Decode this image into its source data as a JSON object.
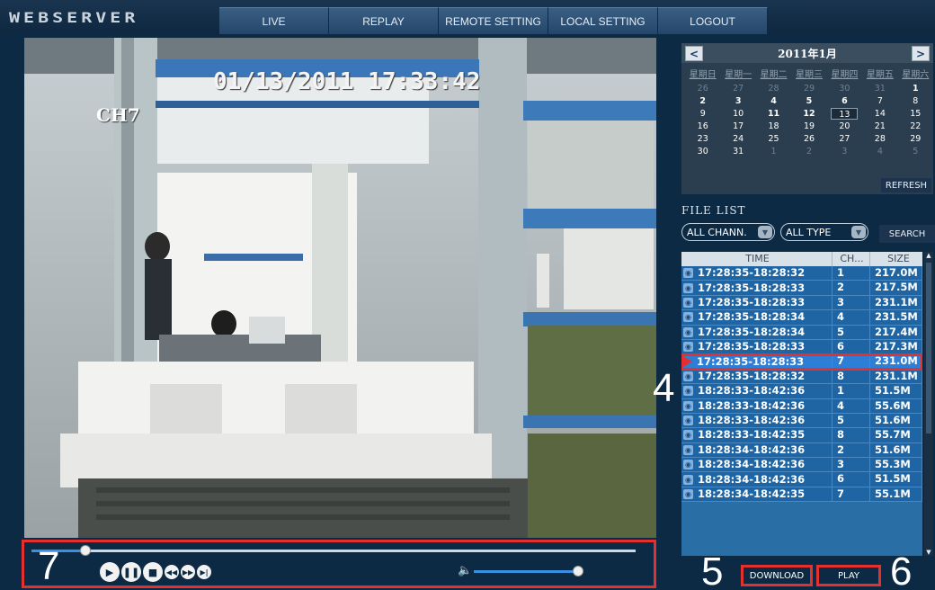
{
  "app": {
    "logo": "WEBSERVER"
  },
  "nav": {
    "tabs": [
      "LIVE",
      "REPLAY",
      "REMOTE SETTING",
      "LOCAL SETTING",
      "LOGOUT"
    ]
  },
  "video": {
    "timestamp": "01/13/2011 17:33:42",
    "channel": "CH7"
  },
  "player": {
    "progress": 0.09,
    "volume": 1.0,
    "buttons": [
      "play-icon",
      "pause-icon",
      "stop-icon",
      "rewind-icon",
      "fast-forward-icon",
      "step-icon"
    ],
    "volume_icon": "speaker-icon"
  },
  "callouts": {
    "four": "4",
    "five": "5",
    "six": "6",
    "seven": "7"
  },
  "calendar": {
    "prev": "<",
    "next": ">",
    "month": "2011年1月",
    "weekdays": [
      "星期日",
      "星期一",
      "星期二",
      "星期三",
      "星期四",
      "星期五",
      "星期六"
    ],
    "days": [
      [
        "26",
        "m"
      ],
      [
        "27",
        "m"
      ],
      [
        "28",
        "m"
      ],
      [
        "29",
        "m"
      ],
      [
        "30",
        "m"
      ],
      [
        "31",
        "m"
      ],
      [
        "1",
        "b"
      ],
      [
        "2",
        "b"
      ],
      [
        "3",
        "b"
      ],
      [
        "4",
        "b"
      ],
      [
        "5",
        "b"
      ],
      [
        "6",
        "b"
      ],
      [
        "7",
        ""
      ],
      [
        "8",
        ""
      ],
      [
        "9",
        ""
      ],
      [
        "10",
        ""
      ],
      [
        "11",
        "b"
      ],
      [
        "12",
        "b"
      ],
      [
        "13",
        "s"
      ],
      [
        "14",
        ""
      ],
      [
        "15",
        ""
      ],
      [
        "16",
        ""
      ],
      [
        "17",
        ""
      ],
      [
        "18",
        ""
      ],
      [
        "19",
        ""
      ],
      [
        "20",
        ""
      ],
      [
        "21",
        ""
      ],
      [
        "22",
        ""
      ],
      [
        "23",
        ""
      ],
      [
        "24",
        ""
      ],
      [
        "25",
        ""
      ],
      [
        "26",
        ""
      ],
      [
        "27",
        ""
      ],
      [
        "28",
        ""
      ],
      [
        "29",
        ""
      ],
      [
        "30",
        ""
      ],
      [
        "31",
        ""
      ],
      [
        "1",
        "m"
      ],
      [
        "2",
        "m"
      ],
      [
        "3",
        "m"
      ],
      [
        "4",
        "m"
      ],
      [
        "5",
        "m"
      ]
    ],
    "refresh": "REFRESH"
  },
  "file_list": {
    "title": "FILE LIST",
    "channel_select": "ALL CHANN.",
    "type_select": "ALL TYPE",
    "search": "SEARCH",
    "columns": [
      "TIME",
      "CH...",
      "SIZE"
    ],
    "rows": [
      [
        "17:28:35-18:28:32",
        "1",
        "217.0M"
      ],
      [
        "17:28:35-18:28:33",
        "2",
        "217.5M"
      ],
      [
        "17:28:35-18:28:33",
        "3",
        "231.1M"
      ],
      [
        "17:28:35-18:28:34",
        "4",
        "231.5M"
      ],
      [
        "17:28:35-18:28:34",
        "5",
        "217.4M"
      ],
      [
        "17:28:35-18:28:33",
        "6",
        "217.3M"
      ],
      [
        "17:28:35-18:28:33",
        "7",
        "231.0M"
      ],
      [
        "17:28:35-18:28:32",
        "8",
        "231.1M"
      ],
      [
        "18:28:33-18:42:36",
        "1",
        "51.5M"
      ],
      [
        "18:28:33-18:42:36",
        "4",
        "55.6M"
      ],
      [
        "18:28:33-18:42:36",
        "5",
        "51.6M"
      ],
      [
        "18:28:33-18:42:35",
        "8",
        "55.7M"
      ],
      [
        "18:28:34-18:42:36",
        "2",
        "51.6M"
      ],
      [
        "18:28:34-18:42:36",
        "3",
        "55.3M"
      ],
      [
        "18:28:34-18:42:36",
        "6",
        "51.5M"
      ],
      [
        "18:28:34-18:42:35",
        "7",
        "55.1M"
      ]
    ],
    "active_row": 6
  },
  "actions": {
    "download": "DOWNLOAD",
    "play": "PLAY"
  }
}
